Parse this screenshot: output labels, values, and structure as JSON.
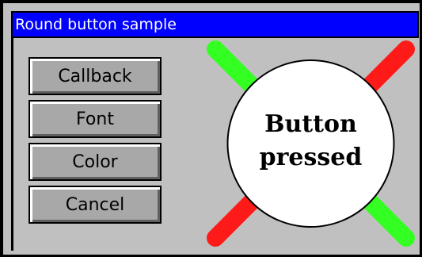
{
  "window": {
    "title": "Round button sample"
  },
  "buttons": [
    {
      "name": "callback-button",
      "label": "Callback"
    },
    {
      "name": "font-button",
      "label": "Font"
    },
    {
      "name": "color-button",
      "label": "Color"
    },
    {
      "name": "cancel-button",
      "label": "Cancel"
    }
  ],
  "round_button": {
    "line1": "Button",
    "line2": "pressed",
    "fill_color": "#ffffff",
    "text_color": "#000000"
  },
  "colors": {
    "title_bar": "#0000ff",
    "background": "#c0c0c0",
    "bar_green": "#33ff22",
    "bar_red": "#ff1a1a"
  }
}
